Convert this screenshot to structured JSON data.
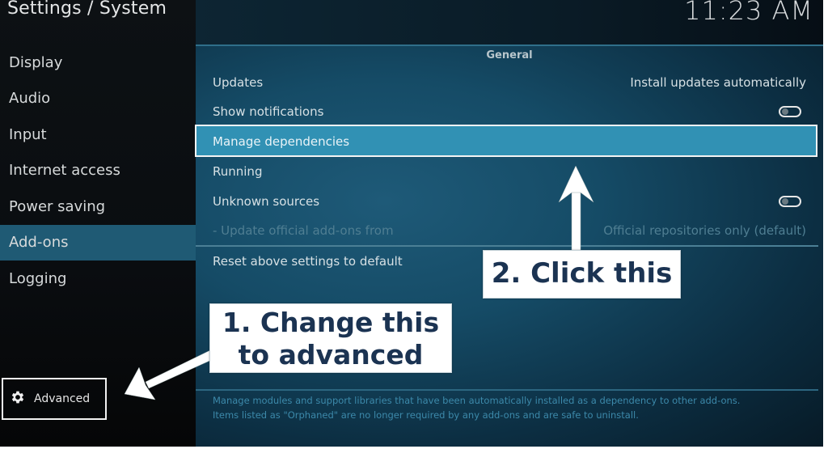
{
  "header": {
    "title": "Settings / System",
    "clock": "11:23 AM"
  },
  "sidebar": {
    "items": [
      {
        "label": "Display",
        "active": false
      },
      {
        "label": "Audio",
        "active": false
      },
      {
        "label": "Input",
        "active": false
      },
      {
        "label": "Internet access",
        "active": false
      },
      {
        "label": "Power saving",
        "active": false
      },
      {
        "label": "Add-ons",
        "active": true
      },
      {
        "label": "Logging",
        "active": false
      }
    ],
    "settings_level": {
      "icon": "gear-icon",
      "label": "Advanced"
    }
  },
  "main": {
    "group_title": "General",
    "rows": [
      {
        "label": "Updates",
        "value": "Install updates automatically"
      },
      {
        "label": "Show notifications",
        "toggle": false
      },
      {
        "label": "Manage dependencies",
        "focused": true
      },
      {
        "label": "Running"
      },
      {
        "label": "Unknown sources",
        "toggle": false
      },
      {
        "label": "- Update official add-ons from",
        "value": "Official repositories only (default)",
        "disabled": true
      },
      {
        "label": "Reset above settings to default"
      }
    ],
    "help_text": [
      "Manage modules and support libraries that have been automatically installed as a dependency to other add-ons.",
      "Items listed as \"Orphaned\" are no longer required by any add-ons and are safe to uninstall."
    ]
  },
  "annotations": {
    "callout_1": [
      "1. Change this",
      "to advanced"
    ],
    "callout_2": "2. Click this"
  }
}
